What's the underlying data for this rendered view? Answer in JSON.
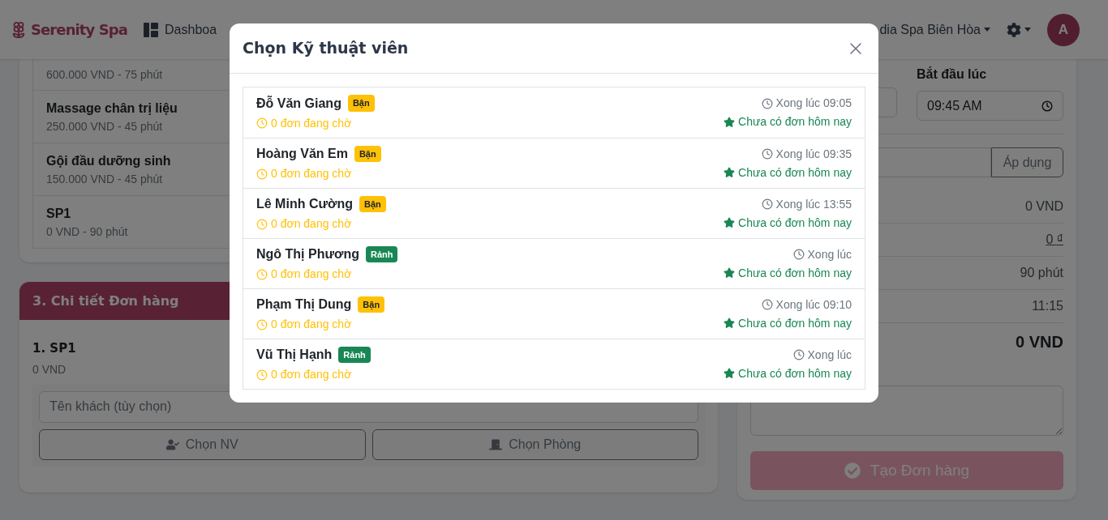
{
  "navbar": {
    "brand": "Serenity Spa",
    "nav_link": "Dashboa",
    "branch": "dia Spa Biên Hòa",
    "avatar": "A"
  },
  "services": [
    {
      "price": "600.000 VND - 75 phút"
    },
    {
      "name": "Massage chân trị liệu",
      "price": "250.000 VND - 45 phút"
    },
    {
      "name": "Gội đầu dưỡng sinh",
      "price": "150.000 VND - 45 phút"
    },
    {
      "name": "SP1",
      "price": "0 VND - 90 phút"
    }
  ],
  "order_details": {
    "title": "3. Chi tiết Đơn hàng",
    "items": [
      {
        "title": "1. SP1",
        "price": "0 VND",
        "customer_placeholder": "Tên khách (tùy chọn)",
        "staff_button": "Chọn NV",
        "room_button": "Chọn Phòng"
      }
    ]
  },
  "booking": {
    "start_label": "Bắt đầu lúc",
    "start_time": "09:45 AM",
    "apply_button": "Áp dụng",
    "summary": [
      {
        "value": "0 VND",
        "kind": "normal"
      },
      {
        "value": "0 ₫",
        "kind": "currency"
      },
      {
        "value": "90 phút",
        "kind": "normal"
      },
      {
        "value": "11:15",
        "kind": "normal"
      },
      {
        "value": "0 VND",
        "kind": "total"
      }
    ],
    "submit": {
      "label": "Tạo Đơn hàng",
      "disabled": true
    }
  },
  "modal": {
    "title": "Chọn Kỹ thuật viên",
    "technicians": [
      {
        "name": "Đỗ Văn Giang",
        "status": {
          "label": "Bận",
          "kind": "busy"
        },
        "pending": "0 đơn đang chờ",
        "finish": "Xong lúc 09:05",
        "note": "Chưa có đơn hôm nay"
      },
      {
        "name": "Hoàng Văn Em",
        "status": {
          "label": "Bận",
          "kind": "busy"
        },
        "pending": "0 đơn đang chờ",
        "finish": "Xong lúc 09:35",
        "note": "Chưa có đơn hôm nay"
      },
      {
        "name": "Lê Minh Cường",
        "status": {
          "label": "Bận",
          "kind": "busy"
        },
        "pending": "0 đơn đang chờ",
        "finish": "Xong lúc 13:55",
        "note": "Chưa có đơn hôm nay"
      },
      {
        "name": "Ngô Thị Phương",
        "status": {
          "label": "Rảnh",
          "kind": "free"
        },
        "pending": "0 đơn đang chờ",
        "finish": "Xong lúc",
        "note": "Chưa có đơn hôm nay"
      },
      {
        "name": "Phạm Thị Dung",
        "status": {
          "label": "Bận",
          "kind": "busy"
        },
        "pending": "0 đơn đang chờ",
        "finish": "Xong lúc 09:10",
        "note": "Chưa có đơn hôm nay"
      },
      {
        "name": "Vũ Thị Hạnh",
        "status": {
          "label": "Rảnh",
          "kind": "free"
        },
        "pending": "0 đơn đang chờ",
        "finish": "Xong lúc",
        "note": "Chưa có đơn hôm nay"
      }
    ]
  }
}
